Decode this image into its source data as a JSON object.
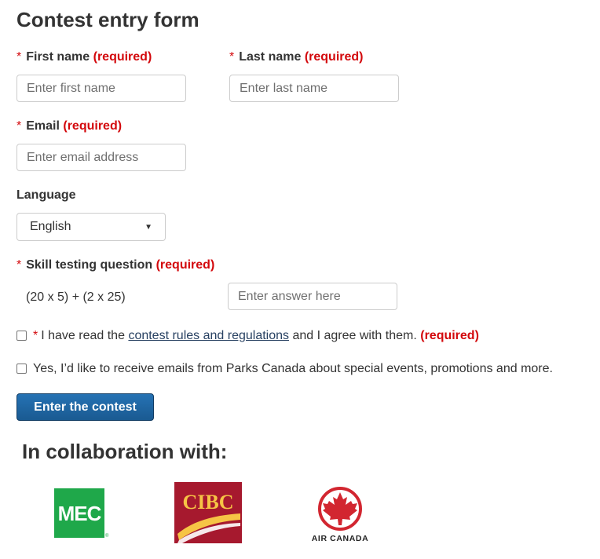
{
  "form": {
    "title": "Contest entry form",
    "required_mark": "*",
    "required_text": "(required)",
    "first_name": {
      "label": "First name",
      "placeholder": "Enter first name"
    },
    "last_name": {
      "label": "Last name",
      "placeholder": "Enter last name"
    },
    "email": {
      "label": "Email",
      "placeholder": "Enter email address"
    },
    "language": {
      "label": "Language",
      "selected": "English"
    },
    "skill": {
      "label": "Skill testing question",
      "question": "(20 x 5) + (2 x 25)",
      "placeholder": "Enter answer here"
    },
    "rules_checkbox": {
      "before": "I have read the",
      "link": "contest rules and regulations",
      "after": "and I agree with them."
    },
    "emails_checkbox": {
      "text": "Yes, I’d like to receive emails from Parks Canada about special events, promotions and more."
    },
    "submit_label": "Enter the contest"
  },
  "collaboration": {
    "heading": "In collaboration with:",
    "logos": [
      {
        "name": "MEC",
        "text": "MEC",
        "color": "#1fa84a"
      },
      {
        "name": "CIBC",
        "text": "CIBC",
        "color": "#a6192e"
      },
      {
        "name": "Air Canada",
        "text": "AIR CANADA",
        "color": "#d22630"
      }
    ]
  },
  "colors": {
    "required": "#d3080c",
    "button": "#1f6aa8",
    "link": "#284162"
  }
}
